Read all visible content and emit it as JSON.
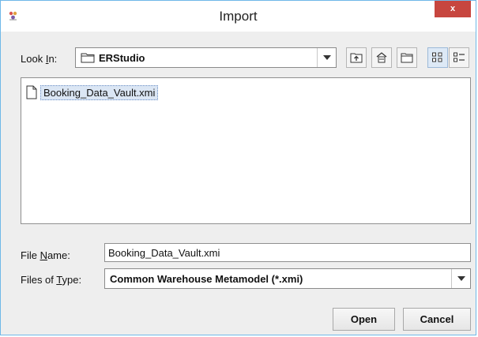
{
  "window": {
    "title": "Import",
    "close_label": "x"
  },
  "look_in": {
    "label_pre": "Look ",
    "label_mnemonic": "I",
    "label_post": "n:",
    "value": "ERStudio",
    "icons": [
      "up-folder-icon",
      "home-icon",
      "new-folder-icon",
      "list-view-icon",
      "details-view-icon"
    ]
  },
  "file_list": {
    "items": [
      {
        "name": "Booking_Data_Vault.xmi",
        "icon": "document-icon",
        "selected": true
      }
    ]
  },
  "file_name": {
    "label_pre": "File ",
    "label_mnemonic": "N",
    "label_post": "ame:",
    "value": "Booking_Data_Vault.xmi"
  },
  "file_type": {
    "label_pre": "Files of ",
    "label_mnemonic": "T",
    "label_post": "ype:",
    "value": "Common Warehouse Metamodel (*.xmi)"
  },
  "buttons": {
    "open": "Open",
    "cancel": "Cancel"
  },
  "colors": {
    "close_button": "#c7463f",
    "selection": "#dbe6f4",
    "window_border": "#6fb8e8"
  }
}
